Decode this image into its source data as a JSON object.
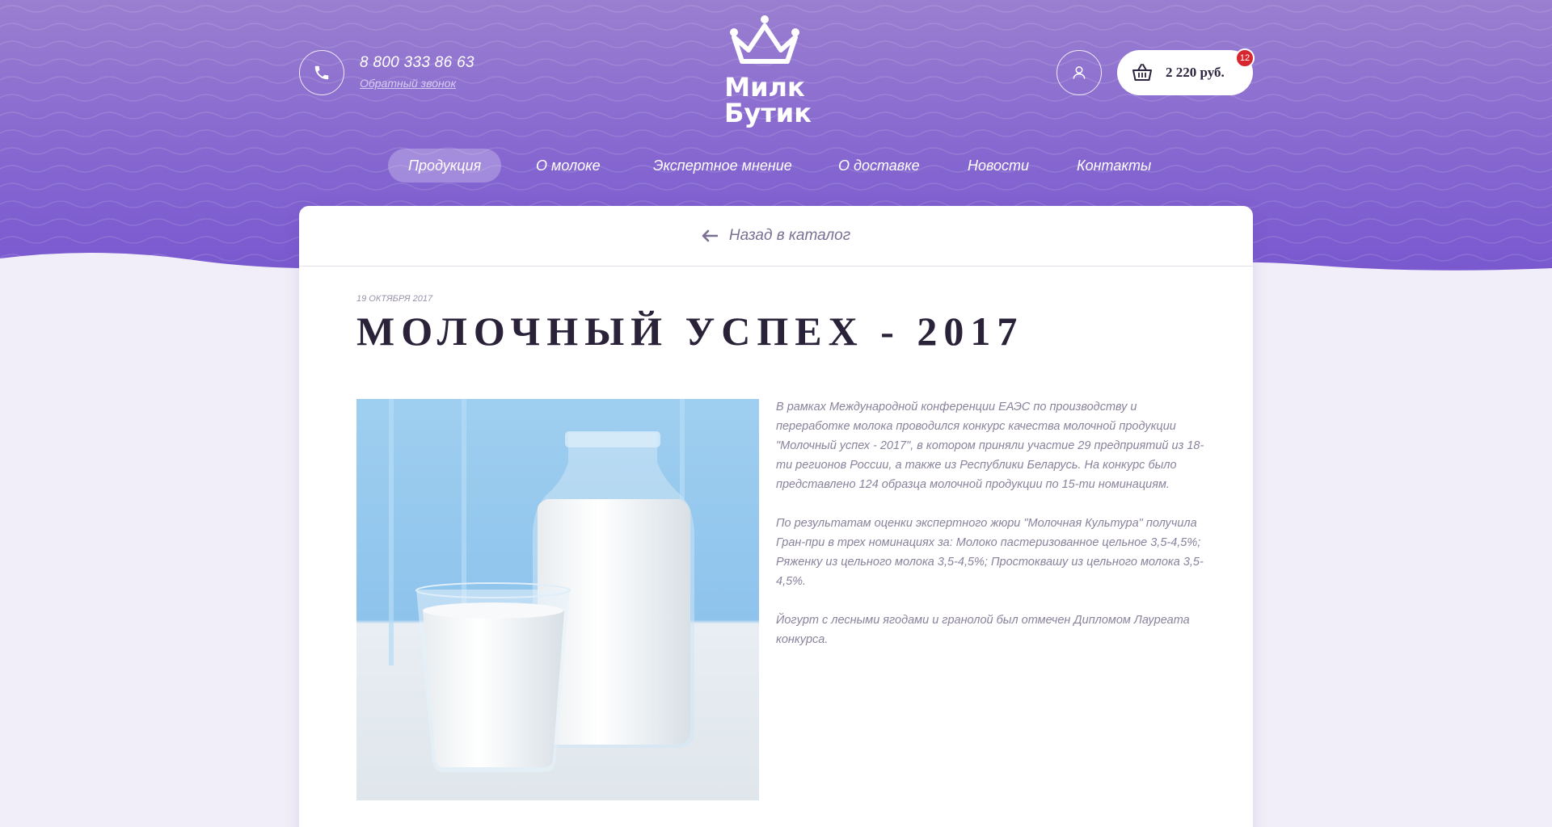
{
  "header": {
    "phone": "8 800 333 86 63",
    "callback_label": "Обратный звонок",
    "logo_line1": "Милк",
    "logo_line2": "Бутик",
    "cart_total": "2 220 руб.",
    "cart_count": "12"
  },
  "nav": {
    "items": [
      {
        "label": "Продукция",
        "active": true
      },
      {
        "label": "О молоке"
      },
      {
        "label": "Экспертное мнение"
      },
      {
        "label": "О доставке"
      },
      {
        "label": "Новости"
      },
      {
        "label": "Контакты"
      }
    ]
  },
  "article": {
    "back_label": "Назад в каталог",
    "date": "19 октября 2017",
    "title": "МОЛОЧНЫЙ УСПЕХ - 2017",
    "paragraphs": [
      "В рамках Международной конференции ЕАЭС по производству и переработке молока проводился конкурс качества молочной продукции \"Молочный успех - 2017\", в котором приняли участие 29 предприятий из 18-ти регионов России, а также из Республики Беларусь. На конкурс было представлено 124 образца молочной продукции по 15-ти номинациям.",
      "По результатам оценки экспертного жюри \"Молочная Культура\" получила Гран-при в трех номинациях за: Молоко пастеризованное цельное 3,5-4,5%; Ряженку из цельного молока 3,5-4,5%; Простоквашу из цельного молока 3,5-4,5%.",
      "Йогурт с лесными ягодами и гранолой был отмечен Дипломом Лауреата конкурса."
    ]
  },
  "colors": {
    "brand_purple": "#7d5fd0",
    "badge_red": "#d8262f",
    "text_muted": "#8a829c"
  },
  "icons": {
    "phone": "phone-icon",
    "user": "user-icon",
    "cart": "basket-icon",
    "back": "arrow-left-icon",
    "logo_crown": "crown-icon"
  }
}
